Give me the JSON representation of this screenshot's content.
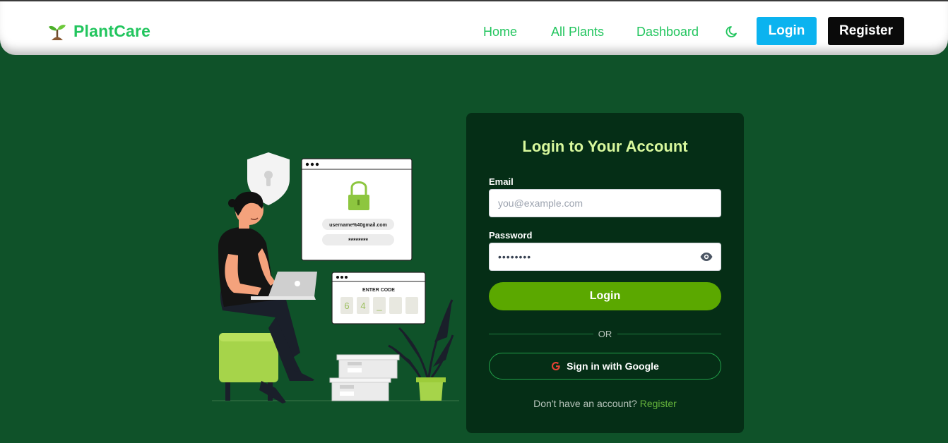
{
  "brand": {
    "name": "PlantCare",
    "icon": "sprout-icon"
  },
  "nav": {
    "links": [
      "Home",
      "All Plants",
      "Dashboard"
    ],
    "theme_icon": "moon-icon",
    "login_label": "Login",
    "register_label": "Register"
  },
  "illustration": {
    "username_text": "username%40gmail.com",
    "password_text": "********",
    "code_title": "ENTER CODE",
    "code_digits": [
      "6",
      "4",
      "_"
    ]
  },
  "login_card": {
    "title": "Login to Your Account",
    "email_label": "Email",
    "email_placeholder": "you@example.com",
    "password_label": "Password",
    "password_value": "••••••••",
    "submit_label": "Login",
    "divider_text": "OR",
    "google_label": "Sign in with Google",
    "footer_text": "Don't have an account?",
    "footer_link": "Register"
  },
  "colors": {
    "page_bg": "#0f5229",
    "card_bg": "#052e16",
    "brand_green": "#22c55e",
    "title_lime": "#d9f99d",
    "login_blue": "#0bb3ef",
    "submit_green": "#5ba800"
  }
}
